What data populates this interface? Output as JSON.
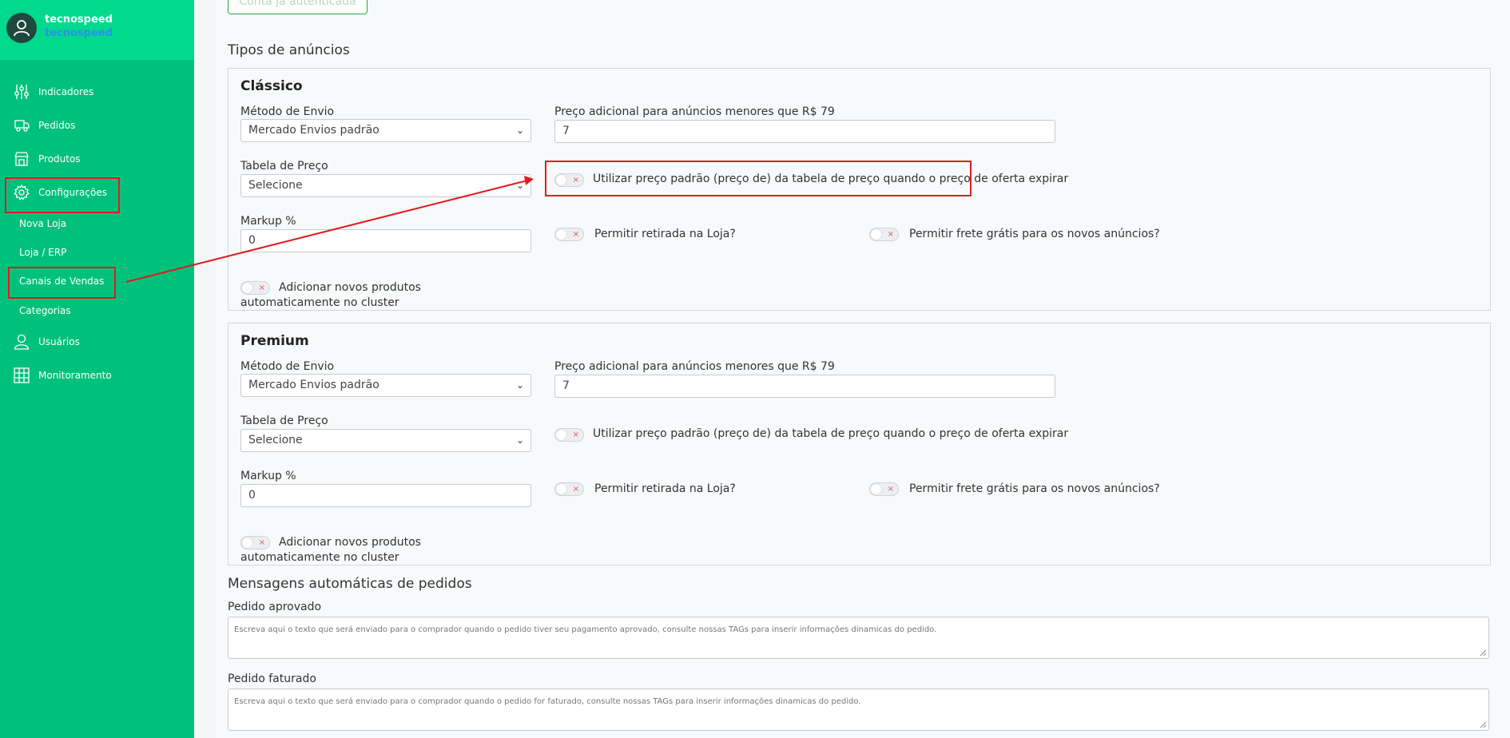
{
  "brand": {
    "name": "tecnospeed",
    "sub": "tecnospeed"
  },
  "sidebar": {
    "items": [
      {
        "label": "Indicadores",
        "icon": "sliders-icon"
      },
      {
        "label": "Pedidos",
        "icon": "truck-icon"
      },
      {
        "label": "Produtos",
        "icon": "store-icon"
      },
      {
        "label": "Configurações",
        "icon": "gear-icon"
      },
      {
        "label": "Usuários",
        "icon": "user-icon"
      },
      {
        "label": "Monitoramento",
        "icon": "grid-icon"
      }
    ],
    "subitems": [
      "Nova Loja",
      "Loja / ERP",
      "Canais de Vendas",
      "Categorias"
    ]
  },
  "main": {
    "auth_button": "Conta já autenticada",
    "ad_types_title": "Tipos de anúncios",
    "sections": [
      {
        "title": "Clássico",
        "shipping_label": "Método de Envio",
        "shipping_value": "Mercado Envios padrão",
        "extra_price_label": "Preço adicional para anúncios menores que R$ 79",
        "extra_price_value": "7",
        "price_table_label": "Tabela de Preço",
        "price_table_value": "Selecione",
        "use_default_price_label": "Utilizar preço padrão (preço de) da tabela de preço quando o preço de oferta expirar",
        "markup_label": "Markup %",
        "markup_value": "0",
        "store_pickup_label": "Permitir retirada na Loja?",
        "free_shipping_label": "Permitir frete grátis para os novos anúncios?",
        "auto_add_label_1": "Adicionar novos produtos",
        "auto_add_label_2": "automaticamente no cluster"
      },
      {
        "title": "Premium",
        "shipping_label": "Método de Envio",
        "shipping_value": "Mercado Envios padrão",
        "extra_price_label": "Preço adicional para anúncios menores que R$ 79",
        "extra_price_value": "7",
        "price_table_label": "Tabela de Preço",
        "price_table_value": "Selecione",
        "use_default_price_label": "Utilizar preço padrão (preço de) da tabela de preço quando o preço de oferta expirar",
        "markup_label": "Markup %",
        "markup_value": "0",
        "store_pickup_label": "Permitir retirada na Loja?",
        "free_shipping_label": "Permitir frete grátis para os novos anúncios?",
        "auto_add_label_1": "Adicionar novos produtos",
        "auto_add_label_2": "automaticamente no cluster"
      }
    ],
    "messages_title": "Mensagens automáticas de pedidos",
    "approved_label": "Pedido aprovado",
    "approved_placeholder": "Escreva aqui o texto que será enviado para o comprador quando o pedido tiver seu pagamento aprovado, consulte nossas TAGs para inserir informações dinamicas do pedido.",
    "invoiced_label": "Pedido faturado",
    "invoiced_placeholder": "Escreva aqui o texto que será enviado para o comprador quando o pedido for faturado, consulte nossas TAGs para inserir informações dinamicas do pedido."
  },
  "colors": {
    "sidebar": "#00c17c",
    "brand_bg": "#00d98e",
    "highlight": "#e11b22"
  }
}
